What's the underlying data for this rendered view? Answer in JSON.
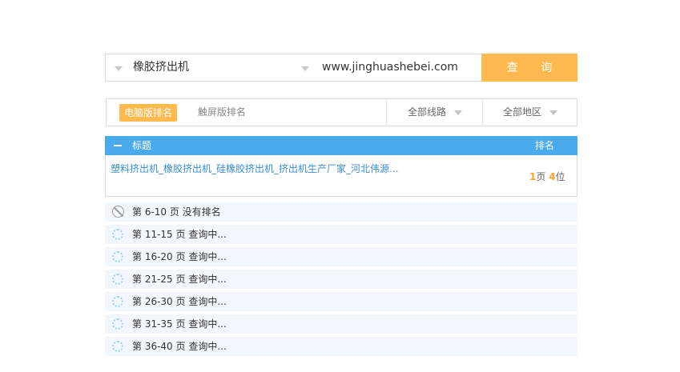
{
  "search": {
    "keyword": "橡胶挤出机",
    "domain": "www.jinghuashebei.com",
    "query_label": "查 询"
  },
  "filters": {
    "tab_pc": "电脑版排名",
    "tab_mobile": "触屏版排名",
    "route": "全部线路",
    "region": "全部地区"
  },
  "table": {
    "col_title": "标题",
    "col_rank": "排名",
    "result": {
      "title": "塑料挤出机_橡胶挤出机_硅橡胶挤出机_挤出机生产厂家_河北伟源...",
      "page": "1",
      "page_unit": "页",
      "position": "4",
      "position_unit": "位"
    }
  },
  "pages": [
    {
      "label": "第 6-10 页 没有排名",
      "status": "no-rank"
    },
    {
      "label": "第 11-15 页 查询中...",
      "status": "loading"
    },
    {
      "label": "第 16-20 页 查询中...",
      "status": "loading"
    },
    {
      "label": "第 21-25 页 查询中...",
      "status": "loading"
    },
    {
      "label": "第 26-30 页 查询中...",
      "status": "loading"
    },
    {
      "label": "第 31-35 页 查询中...",
      "status": "loading"
    },
    {
      "label": "第 36-40 页 查询中...",
      "status": "loading"
    }
  ],
  "colors": {
    "accent": "#ffba4f",
    "header_blue": "#4aabec",
    "link_blue": "#3a8ed8",
    "row_bg": "#f1f7fd"
  }
}
